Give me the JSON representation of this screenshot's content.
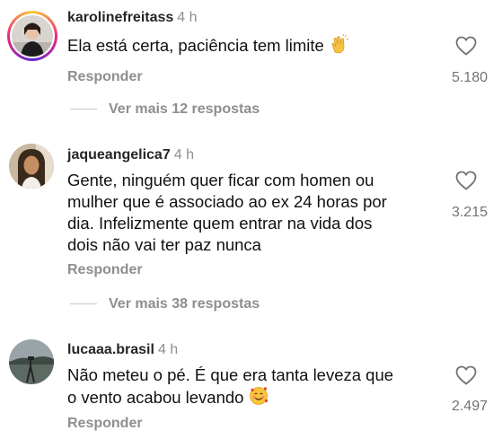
{
  "comments": [
    {
      "username": "karolinefreitass",
      "time": "4 h",
      "text": "Ela está certa, paciência tem limite",
      "emoji": "clapping-hands-icon",
      "reply_label": "Responder",
      "likes": "5.180",
      "more_replies": "Ver mais 12 respostas"
    },
    {
      "username": "jaqueangelica7",
      "time": "4 h",
      "text_lines": [
        "Gente, ninguém quer ficar com homen ou",
        "mulher que é associado ao ex 24 horas por",
        "dia. Infelizmente quem entrar na vida dos",
        "dois não vai ter paz nunca"
      ],
      "reply_label": "Responder",
      "likes": "3.215",
      "more_replies": "Ver mais 38 respostas"
    },
    {
      "username": "lucaaa.brasil",
      "time": "4 h",
      "text_lines": [
        "Não meteu o pé. É que era tanta leveza que",
        "o vento acabou levando"
      ],
      "emoji": "smiling-face-with-hearts-icon",
      "reply_label": "Responder",
      "likes": "2.497"
    }
  ],
  "colors": {
    "text": "#111111",
    "secondary": "#8e8e8e",
    "likes": "#737373",
    "story_ring": [
      "#f9ce34",
      "#ee2a7b",
      "#6228d7"
    ]
  }
}
